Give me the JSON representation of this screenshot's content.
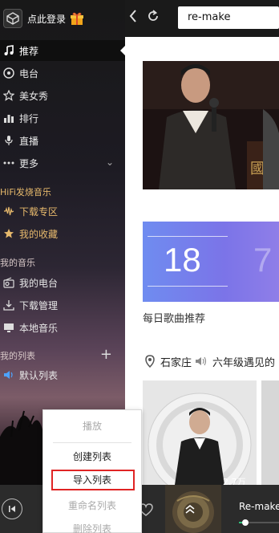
{
  "user": {
    "login_text": "点此登录"
  },
  "search": {
    "query": "re-make"
  },
  "nav": {
    "top_items": [
      {
        "label": "推荐",
        "icon": "music-note-icon",
        "active": true
      },
      {
        "label": "电台",
        "icon": "radio-icon"
      },
      {
        "label": "美女秀",
        "icon": "star-icon"
      },
      {
        "label": "排行",
        "icon": "chart-bars-icon"
      },
      {
        "label": "直播",
        "icon": "microphone-icon"
      },
      {
        "label": "更多",
        "icon": "more-dots-icon"
      }
    ],
    "hifi_label": "HiFi发烧音乐",
    "hifi_items": [
      {
        "label": "下载专区",
        "icon": "waveform-icon"
      },
      {
        "label": "我的收藏",
        "icon": "star-filled-icon"
      }
    ],
    "my_music_label": "我的音乐",
    "my_music_items": [
      {
        "label": "我的电台",
        "icon": "radio-icon"
      },
      {
        "label": "下载管理",
        "icon": "download-icon"
      },
      {
        "label": "本地音乐",
        "icon": "monitor-icon"
      }
    ],
    "my_lists_label": "我的列表",
    "list_items": [
      {
        "label": "默认列表",
        "icon": "speaker-icon"
      }
    ]
  },
  "main": {
    "daily": {
      "date_number": "18",
      "next_number": "7",
      "label": "每日歌曲推荐"
    },
    "location": {
      "city": "石家庄",
      "song_text": "六年级遇见的"
    },
    "album": {
      "play_count": "2.7万"
    }
  },
  "player": {
    "song_title": "Re-make",
    "progress": 0.08
  },
  "context_menu": {
    "items": [
      {
        "label": "播放",
        "enabled": false
      },
      {
        "label": "创建列表",
        "enabled": true
      },
      {
        "label": "导入列表",
        "enabled": true,
        "highlighted": true
      },
      {
        "label": "重命名列表",
        "enabled": false
      },
      {
        "label": "删除列表",
        "enabled": false
      }
    ]
  },
  "colors": {
    "accent_green": "#31c27c",
    "highlight_red": "#e02424",
    "hifi_gold": "#e7b96c"
  }
}
